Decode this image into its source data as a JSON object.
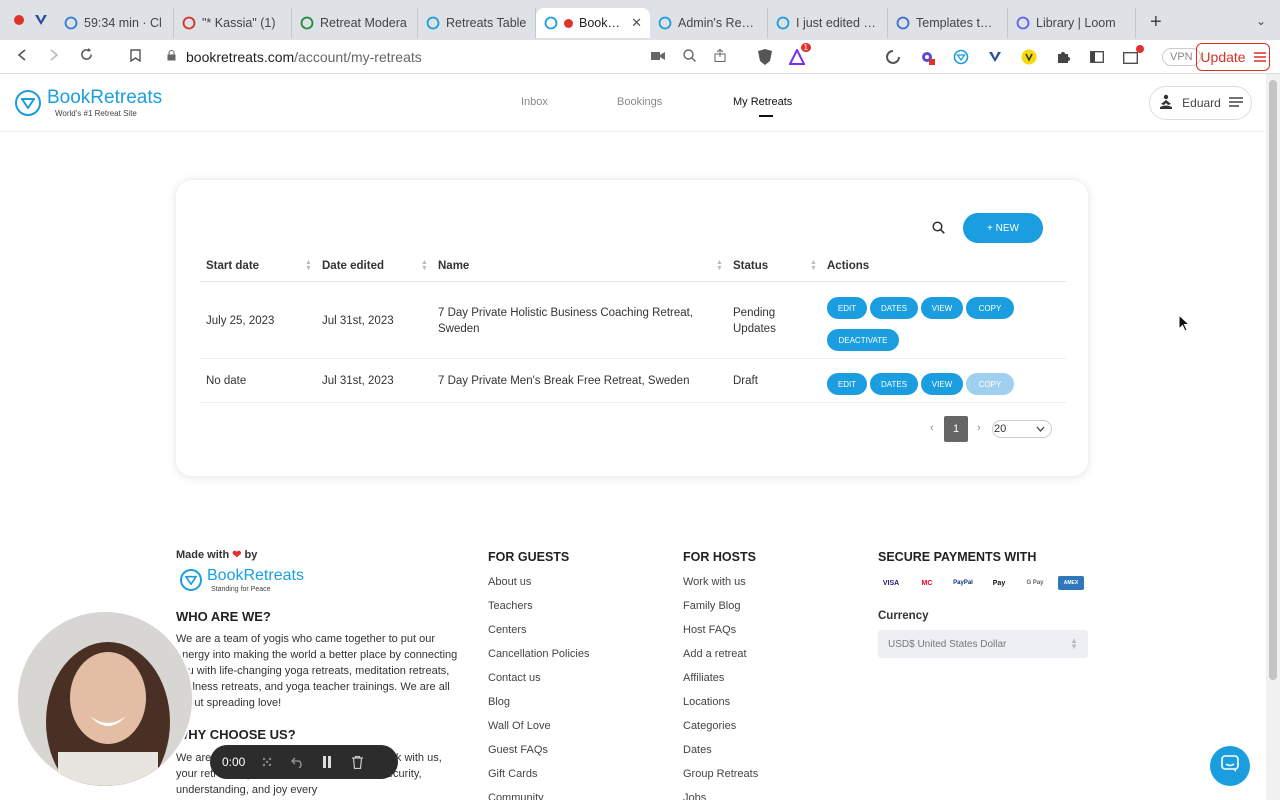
{
  "browser": {
    "tabs": [
      {
        "label": "59:34 min · Cl",
        "icon": "clock-loader-icon",
        "color": "#2f7fd8"
      },
      {
        "label": "\"* Kassia\" (1)",
        "icon": "gmail-icon",
        "color": "#d93025"
      },
      {
        "label": "Retreat Modera",
        "icon": "sheets-icon",
        "color": "#1e8e3e"
      },
      {
        "label": "Retreats Table",
        "icon": "bookretreats-icon",
        "color": "#1a9ee0"
      },
      {
        "label": "BookRet",
        "icon": "bookretreats-icon",
        "color": "#1a9ee0",
        "active": true
      },
      {
        "label": "Admin's Review",
        "icon": "bookretreats-icon",
        "color": "#1a9ee0"
      },
      {
        "label": "I just edited my",
        "icon": "bookretreats-icon",
        "color": "#1a9ee0"
      },
      {
        "label": "Templates to Im",
        "icon": "docs-icon",
        "color": "#3b6fd6"
      },
      {
        "label": "Library | Loom",
        "icon": "loom-icon",
        "color": "#625df5"
      }
    ],
    "url_domain": "bookretreats.com",
    "url_path": "/account/my-retreats",
    "vpn_label": "VPN",
    "update_label": "Update",
    "extension_badge": "1"
  },
  "header": {
    "brand": "BookRetreats",
    "tagline": "World's #1 Retreat Site",
    "nav": {
      "inbox": "Inbox",
      "bookings": "Bookings",
      "my_retreats": "My Retreats"
    },
    "user_name": "Eduard"
  },
  "table": {
    "new_label": "+ NEW",
    "columns": {
      "start_date": "Start date",
      "date_edited": "Date edited",
      "name": "Name",
      "status": "Status",
      "actions": "Actions"
    },
    "rows": [
      {
        "start_date": "July 25, 2023",
        "date_edited": "Jul 31st, 2023",
        "name": "7 Day Private Holistic Business Coaching Retreat, Sweden",
        "status": "Pending Updates",
        "actions": {
          "edit": "EDIT",
          "dates": "DATES",
          "view": "VIEW",
          "copy": "COPY",
          "deactivate": "DEACTIVATE"
        }
      },
      {
        "start_date": "No date",
        "date_edited": "Jul 31st, 2023",
        "name": "7 Day Private Men's Break Free Retreat, Sweden",
        "status": "Draft",
        "actions": {
          "edit": "EDIT",
          "dates": "DATES",
          "view": "VIEW",
          "copy": "COPY"
        }
      }
    ],
    "pagination": {
      "prev": "‹",
      "current": "1",
      "next": "›",
      "page_size": "20"
    }
  },
  "footer": {
    "made_with": "Made with",
    "by": "by",
    "brand": "BookRetreats",
    "brand_tag": "Standing for Peace",
    "who_title": "WHO ARE WE?",
    "who_text": "We are a team of yogis who came together to put our energy into making the world a better place by connecting you with life-changing yoga retreats, meditation retreats, wellness retreats, and yoga teacher trainings. We are all about spreading love!",
    "why_title": "WHY CHOOSE US?",
    "why_text": "We are here to make sure that when you book with us, your retreat experience will be full of love, security, understanding, and joy every",
    "guests_title": "FOR GUESTS",
    "guests_links": [
      "About us",
      "Teachers",
      "Centers",
      "Cancellation Policies",
      "Contact us",
      "Blog",
      "Wall Of Love",
      "Guest FAQs",
      "Gift Cards",
      "Community"
    ],
    "hosts_title": "FOR HOSTS",
    "hosts_links": [
      "Work with us",
      "Family Blog",
      "Host FAQs",
      "Add a retreat",
      "Affiliates",
      "Locations",
      "Categories",
      "Dates",
      "Group Retreats",
      "Jobs"
    ],
    "payments_title": "SECURE PAYMENTS WITH",
    "payment_methods": [
      "VISA",
      "MC",
      "PayPal",
      "Pay",
      "G Pay",
      "AMEX"
    ],
    "currency_label": "Currency",
    "currency_value": "USD$ United States Dollar"
  },
  "recorder": {
    "time": "0:00"
  },
  "colors": {
    "brand": "#1a9ee0",
    "disabled": "#9fd0ef",
    "heart": "#e0322d"
  }
}
